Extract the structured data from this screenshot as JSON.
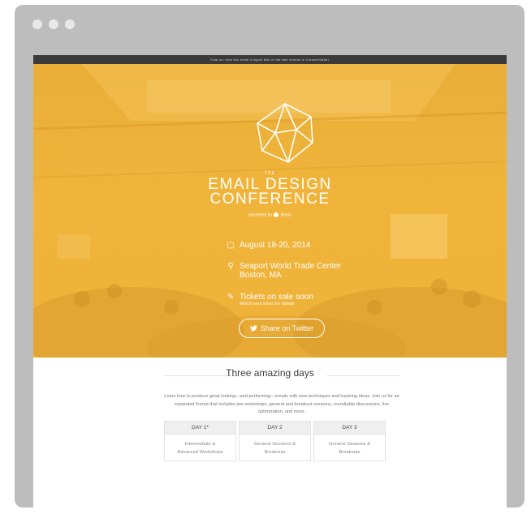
{
  "topbar": {
    "text": "Trust us: view this email in Apple Mail or the web version in Chrome/Safari."
  },
  "hero": {
    "the": "THE",
    "title_line1": "EMAIL DESIGN",
    "title_line2": "CONFERENCE",
    "presented_by": "presented by",
    "presenter": "litmus",
    "date": "August 18-20, 2014",
    "venue_line1": "Seaport World Trade Center",
    "venue_line2": "Boston, MA",
    "tickets": "Tickets on sale soon",
    "tickets_sub": "Watch your inbox for details",
    "share_label": "Share on Twitter"
  },
  "content": {
    "heading": "Three amazing days",
    "description": "Learn how to produce great looking—and performing—emails with new techniques and inspiring ideas. Join us for an expanded format that includes two workshops, general and breakout sessions, roundtable discussions, live optimization, and more.",
    "days": [
      {
        "label": "DAY 1*",
        "line1": "Intermediate &",
        "line2": "Advanced Workshops"
      },
      {
        "label": "DAY 2",
        "line1": "General Sessions &",
        "line2": "Breakouts"
      },
      {
        "label": "DAY 3",
        "line1": "General Sessions &",
        "line2": "Breakouts"
      }
    ]
  },
  "colors": {
    "hero": "#f0b43a",
    "frame": "#bdbdbd",
    "topbar": "#3a3a3a"
  },
  "icons": [
    "calendar-icon",
    "location-pin-icon",
    "ticket-icon",
    "twitter-icon",
    "geodesic-logo-icon"
  ]
}
